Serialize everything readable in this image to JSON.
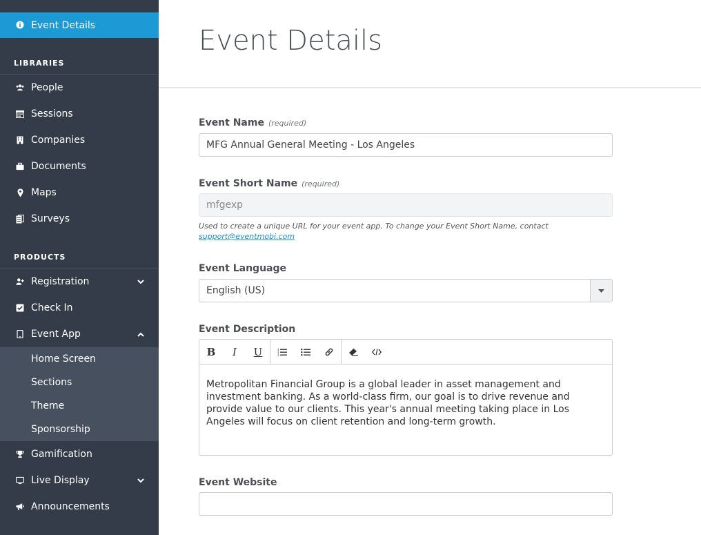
{
  "sidebar": {
    "active_item": "Event Details",
    "libraries_heading": "LIBRARIES",
    "libraries": [
      {
        "label": "People",
        "icon": "people-icon"
      },
      {
        "label": "Sessions",
        "icon": "calendar-icon"
      },
      {
        "label": "Companies",
        "icon": "building-icon"
      },
      {
        "label": "Documents",
        "icon": "briefcase-icon"
      },
      {
        "label": "Maps",
        "icon": "map-pin-icon"
      },
      {
        "label": "Surveys",
        "icon": "clipboard-icon"
      }
    ],
    "products_heading": "PRODUCTS",
    "products": [
      {
        "label": "Registration",
        "icon": "user-plus-icon"
      },
      {
        "label": "Check In",
        "icon": "check-square-icon"
      },
      {
        "label": "Event App",
        "icon": "tablet-icon"
      },
      {
        "label": "Gamification",
        "icon": "trophy-icon"
      },
      {
        "label": "Live Display",
        "icon": "monitor-icon"
      },
      {
        "label": "Announcements",
        "icon": "megaphone-icon"
      }
    ],
    "event_app_subitems": [
      "Home Screen",
      "Sections",
      "Theme",
      "Sponsorship"
    ]
  },
  "page": {
    "title": "Event Details"
  },
  "form": {
    "event_name": {
      "label": "Event Name",
      "required": "(required)",
      "value": "MFG Annual General Meeting - Los Angeles"
    },
    "short_name": {
      "label": "Event Short Name",
      "required": "(required)",
      "value": "mfgexp"
    },
    "short_name_help": "Used to create a unique URL for your event app. To change your Event Short Name, contact",
    "support_link": "support@eventmobi.com",
    "language": {
      "label": "Event Language",
      "value": "English (US)"
    },
    "description": {
      "label": "Event Description",
      "value": "Metropolitan Financial Group is a global leader in asset management and investment banking. As a world-class firm, our goal is to drive revenue and provide value to our clients. This year's annual meeting taking place in Los Angeles will focus on client retention and long-term growth."
    },
    "website": {
      "label": "Event Website",
      "value": ""
    }
  },
  "toolbar": {
    "bold": "B",
    "italic": "I",
    "underline": "U"
  },
  "colors": {
    "sidebar_bg": "#333c48",
    "active_bg": "#1b9ad6",
    "submenu_bg": "#46505e"
  }
}
